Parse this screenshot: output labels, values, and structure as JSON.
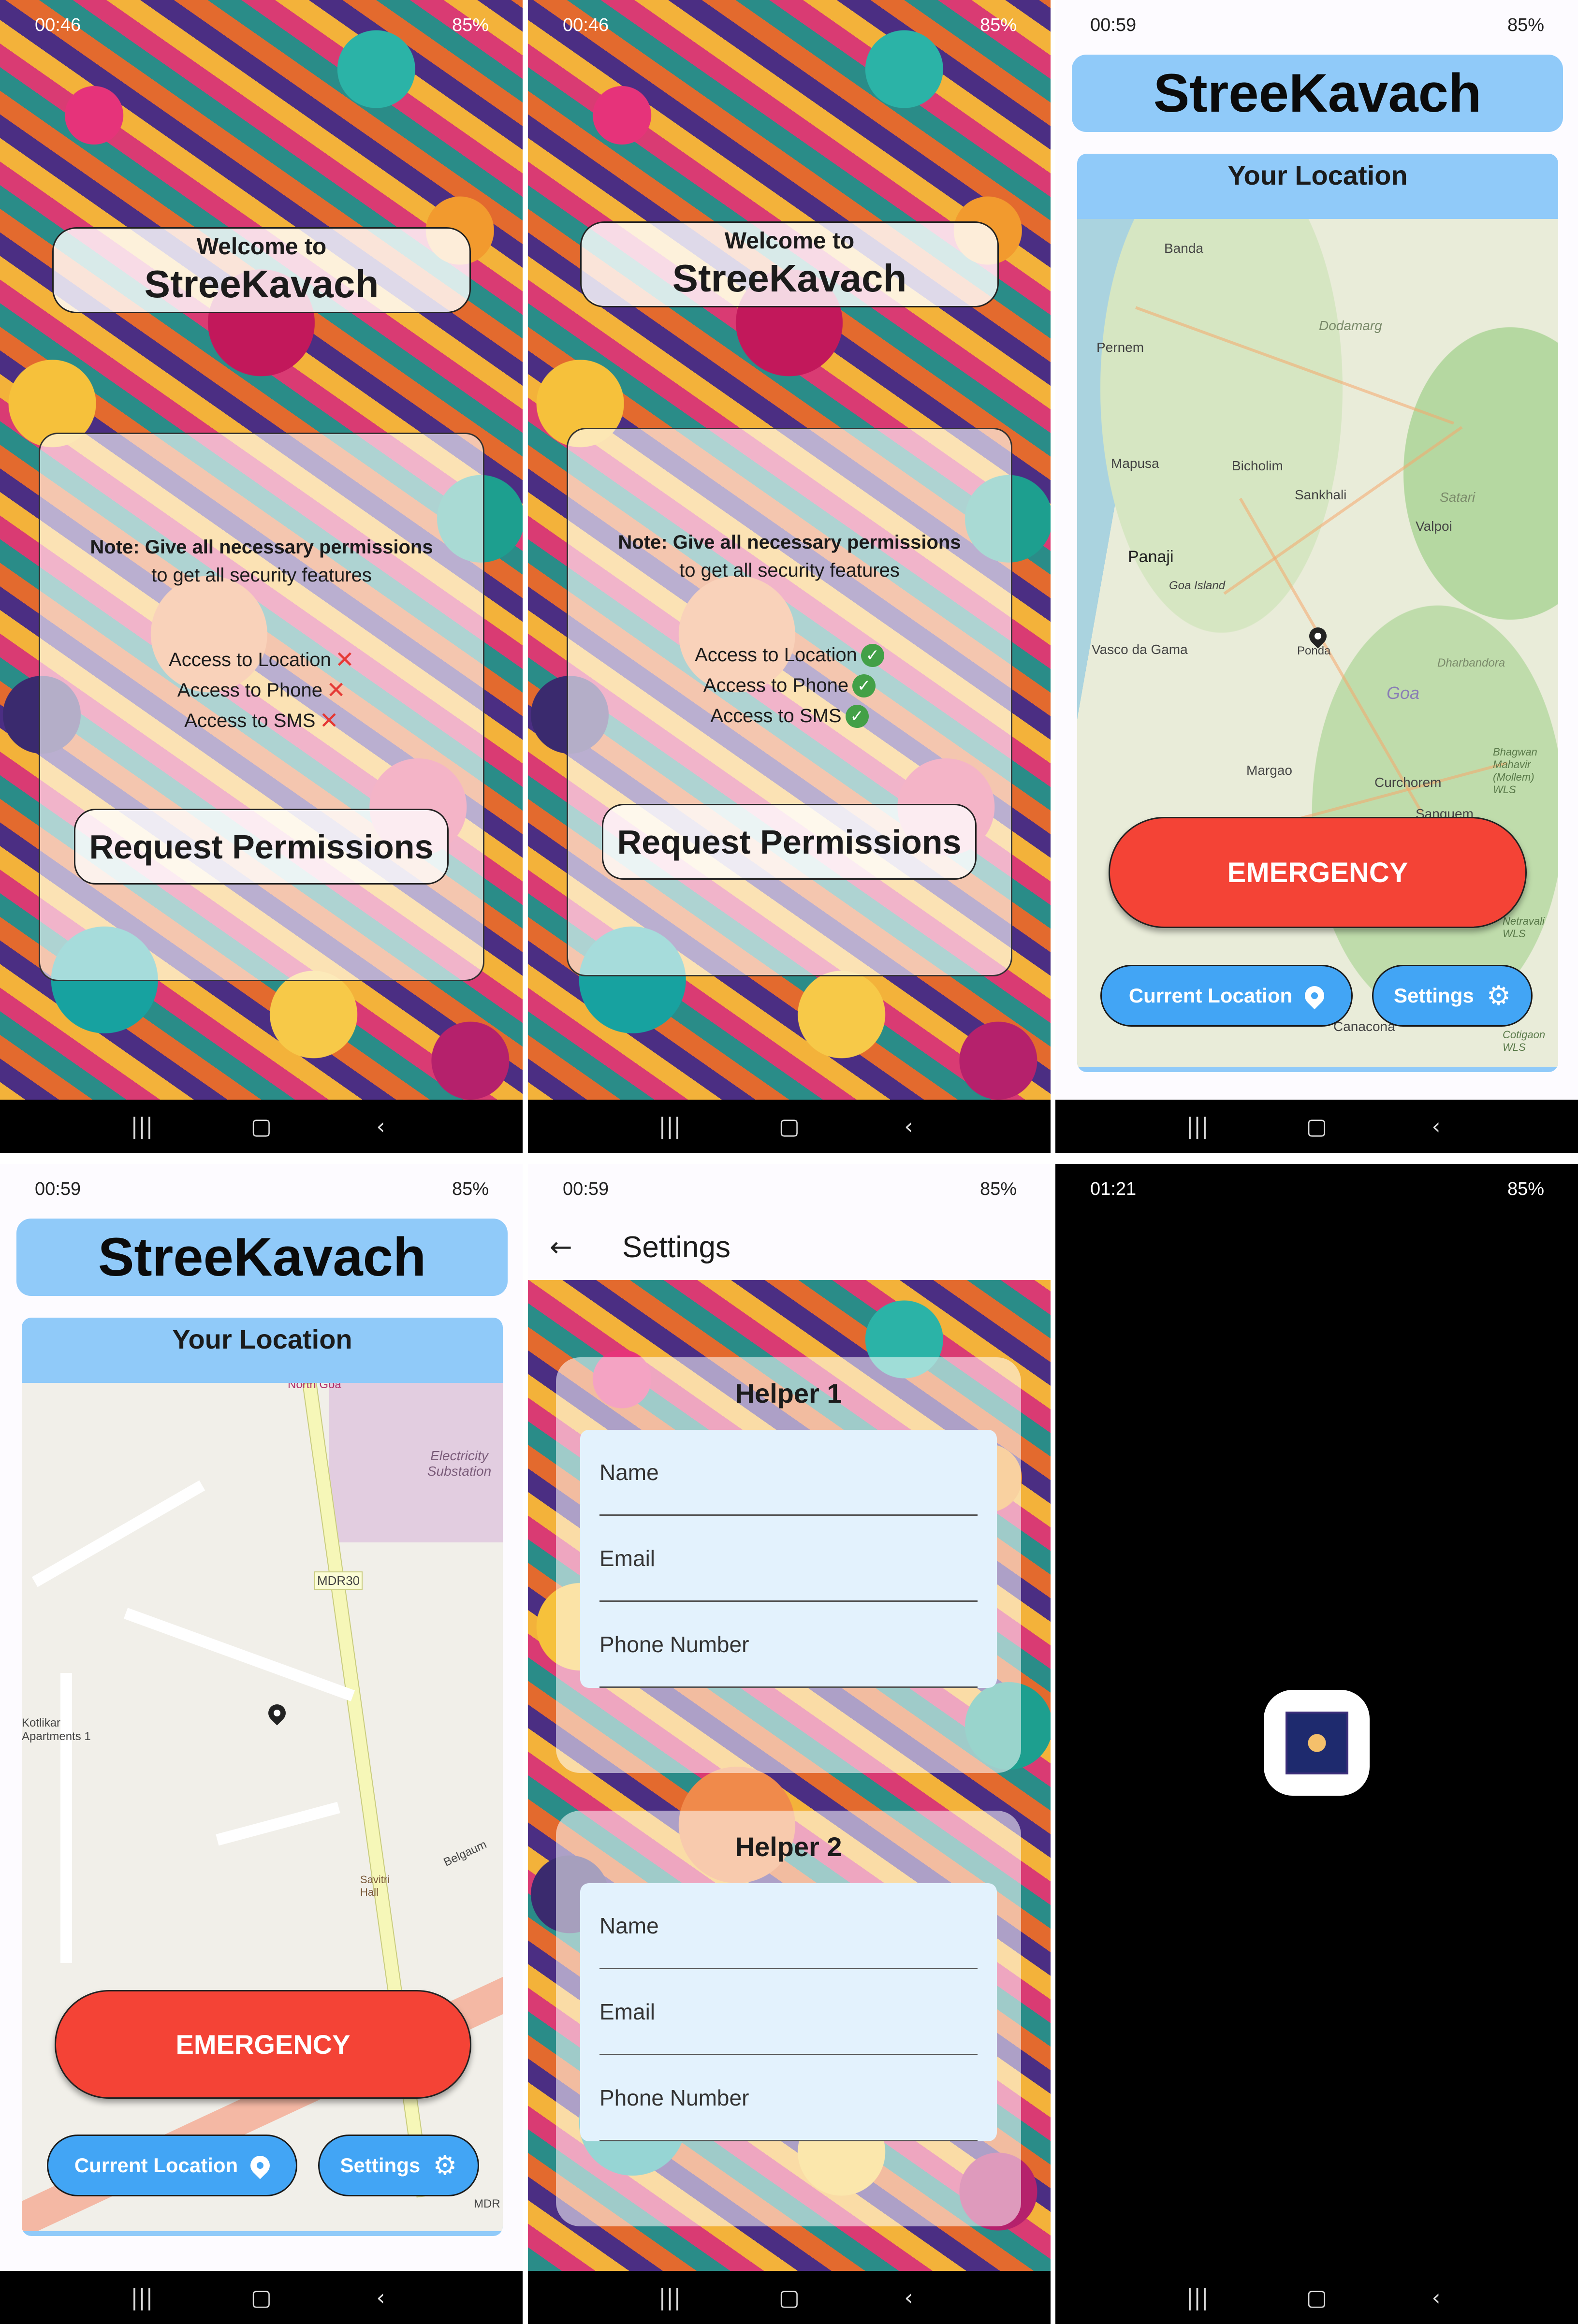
{
  "panel1": {
    "status": {
      "time": "00:46",
      "battery": "85%"
    },
    "welcome_line": "Welcome to",
    "app_name": "StreeKavach",
    "note_bold": "Note: Give all necessary permissions",
    "note_rest": "to get all security features",
    "permissions": [
      {
        "label": "Access to Location",
        "state": "denied"
      },
      {
        "label": "Access to Phone",
        "state": "denied"
      },
      {
        "label": "Access to SMS",
        "state": "denied"
      }
    ],
    "request_button": "Request Permissions"
  },
  "panel2": {
    "status": {
      "time": "00:46",
      "battery": "85%"
    },
    "welcome_line": "Welcome to",
    "app_name": "StreeKavach",
    "note_bold": "Note: Give all necessary permissions",
    "note_rest": "to get all security features",
    "permissions": [
      {
        "label": "Access to Location",
        "state": "granted"
      },
      {
        "label": "Access to Phone",
        "state": "granted"
      },
      {
        "label": "Access to SMS",
        "state": "granted"
      }
    ],
    "request_button": "Request Permissions"
  },
  "panel3": {
    "status": {
      "time": "00:59",
      "battery": "85%"
    },
    "app_name": "StreeKavach",
    "map_title": "Your Location",
    "map_places": [
      "Banda",
      "Dodamarg",
      "Pernem",
      "Mapusa",
      "Bicholim",
      "Sankhali",
      "Satari",
      "Valpoi",
      "Panaji",
      "Goa Island",
      "Vasco da Gama",
      "Ponda",
      "Dharbandora",
      "Goa",
      "Margao",
      "Curchorem",
      "Sanguem",
      "Bhagwan Mahavir (Mollem) WLS",
      "Netravali WLS",
      "Canacona",
      "Cotigaon WLS"
    ],
    "emergency_button": "EMERGENCY",
    "current_location_button": "Current Location",
    "settings_button": "Settings"
  },
  "panel4": {
    "status": {
      "time": "00:59",
      "battery": "85%"
    },
    "app_name": "StreeKavach",
    "map_title": "Your Location",
    "map_places": [
      "North Goa",
      "Electricity Substation",
      "MDR30",
      "Kotlikar Apartments 1",
      "Savitri Hall",
      "Belgaum",
      "MDR"
    ],
    "emergency_button": "EMERGENCY",
    "current_location_button": "Current Location",
    "settings_button": "Settings"
  },
  "panel5": {
    "status": {
      "time": "00:59",
      "battery": "85%"
    },
    "title": "Settings",
    "helpers": [
      {
        "title": "Helper 1",
        "fields": [
          "Name",
          "Email",
          "Phone Number"
        ]
      },
      {
        "title": "Helper 2",
        "fields": [
          "Name",
          "Email",
          "Phone Number"
        ]
      }
    ]
  },
  "panel6": {
    "status": {
      "time": "01:21",
      "battery": "85%"
    }
  },
  "icons": {
    "denied": "close-icon",
    "granted": "check-circle-icon",
    "location": "location-pin-icon",
    "settings": "gear-icon",
    "back": "arrow-back-icon"
  },
  "colors": {
    "app_bar": "#90caf9",
    "emergency": "#f44336",
    "pill_button": "#42a5f5",
    "denied": "#e53935",
    "granted": "#43a047"
  }
}
